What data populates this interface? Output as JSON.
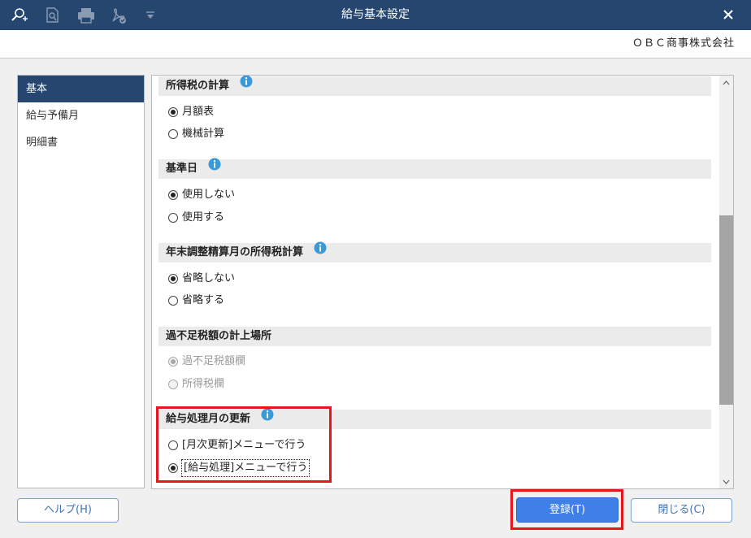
{
  "window": {
    "title": "給与基本設定",
    "company": "ＯＢＣ商事株式会社",
    "toolbar_icons": [
      "search-plus-icon",
      "preview-icon",
      "print-icon",
      "pdf-icon",
      "dropdown-icon"
    ]
  },
  "sidebar": {
    "items": [
      {
        "label": "基本",
        "active": true
      },
      {
        "label": "給与予備月",
        "active": false
      },
      {
        "label": "明細書",
        "active": false
      }
    ]
  },
  "sections": [
    {
      "title": "所得税の計算",
      "has_info": true,
      "options": [
        {
          "label": "月額表",
          "checked": true
        },
        {
          "label": "機械計算",
          "checked": false
        }
      ]
    },
    {
      "title": "基準日",
      "has_info": true,
      "options": [
        {
          "label": "使用しない",
          "checked": true
        },
        {
          "label": "使用する",
          "checked": false
        }
      ]
    },
    {
      "title": "年末調整精算月の所得税計算",
      "has_info": true,
      "options": [
        {
          "label": "省略しない",
          "checked": true
        },
        {
          "label": "省略する",
          "checked": false
        }
      ]
    },
    {
      "title": "過不足税額の計上場所",
      "has_info": false,
      "disabled": true,
      "options": [
        {
          "label": "過不足税額欄",
          "checked": true
        },
        {
          "label": "所得税欄",
          "checked": false
        }
      ]
    },
    {
      "title": "給与処理月の更新",
      "has_info": true,
      "highlighted": true,
      "options": [
        {
          "label": "[月次更新]メニューで行う",
          "checked": false
        },
        {
          "label": "[給与処理]メニューで行う",
          "checked": true,
          "focused": true
        }
      ]
    }
  ],
  "buttons": {
    "help": "ヘルプ(H)",
    "save": "登録(T)",
    "close": "閉じる(C)"
  },
  "colors": {
    "titlebar": "#25476f",
    "accent": "#3e7fe8",
    "highlight": "#e5161c",
    "info": "#3a9ad9"
  }
}
